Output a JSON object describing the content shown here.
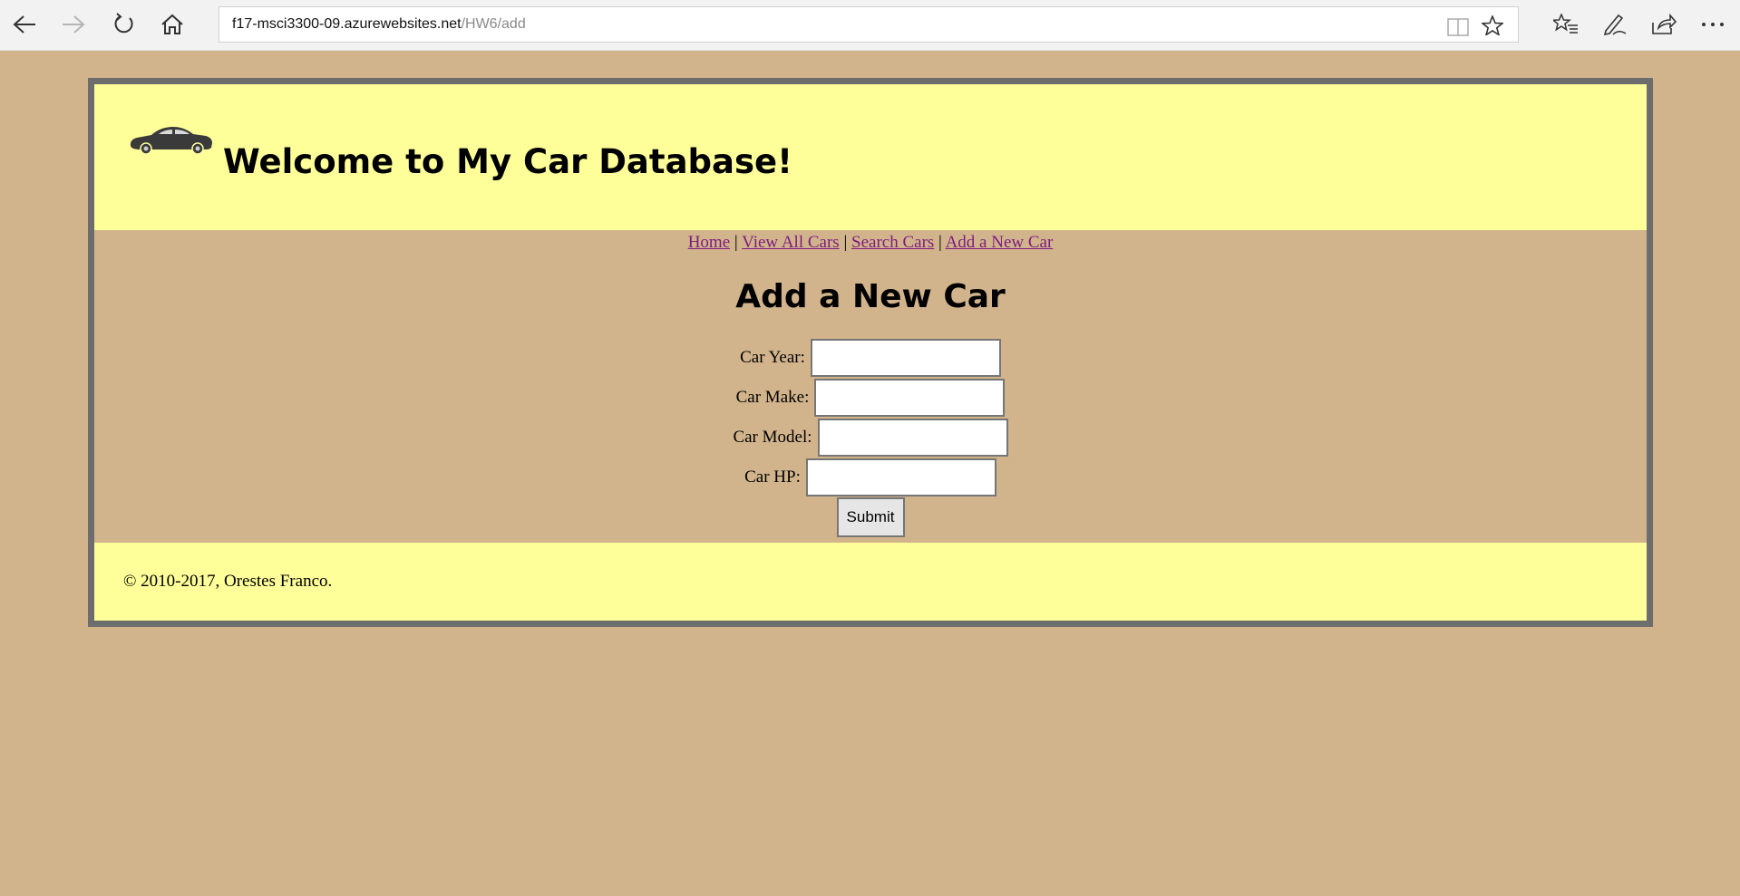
{
  "browser": {
    "url_host": "f17-msci3300-09.azurewebsites.net",
    "url_path": "/HW6/add",
    "icons": [
      "back-icon",
      "forward-icon",
      "refresh-icon",
      "home-icon",
      "reading-view-icon",
      "favorite-star-icon",
      "favorites-hub-icon",
      "web-note-pen-icon",
      "share-icon",
      "more-icon"
    ]
  },
  "header": {
    "title": "Welcome to My Car Database!",
    "logo_icon": "car-icon"
  },
  "nav": {
    "items": [
      {
        "label": "Home"
      },
      {
        "label": "View All Cars"
      },
      {
        "label": "Search Cars"
      },
      {
        "label": "Add a New Car"
      }
    ],
    "separator": "|"
  },
  "main": {
    "heading": "Add a New Car",
    "fields": [
      {
        "label": "Car Year:",
        "value": "",
        "placeholder": ""
      },
      {
        "label": "Car Make:",
        "value": "",
        "placeholder": ""
      },
      {
        "label": "Car Model:",
        "value": "",
        "placeholder": ""
      },
      {
        "label": "Car HP:",
        "value": "",
        "placeholder": ""
      }
    ],
    "submit_label": "Submit"
  },
  "footer": {
    "copyright": "© 2010-2017, Orestes Franco."
  },
  "colors": {
    "page_background": "#d2b48c",
    "header_footer": "#ffff99",
    "frame_border": "#6d6d6d",
    "visited_link": "#7d1b7e"
  }
}
